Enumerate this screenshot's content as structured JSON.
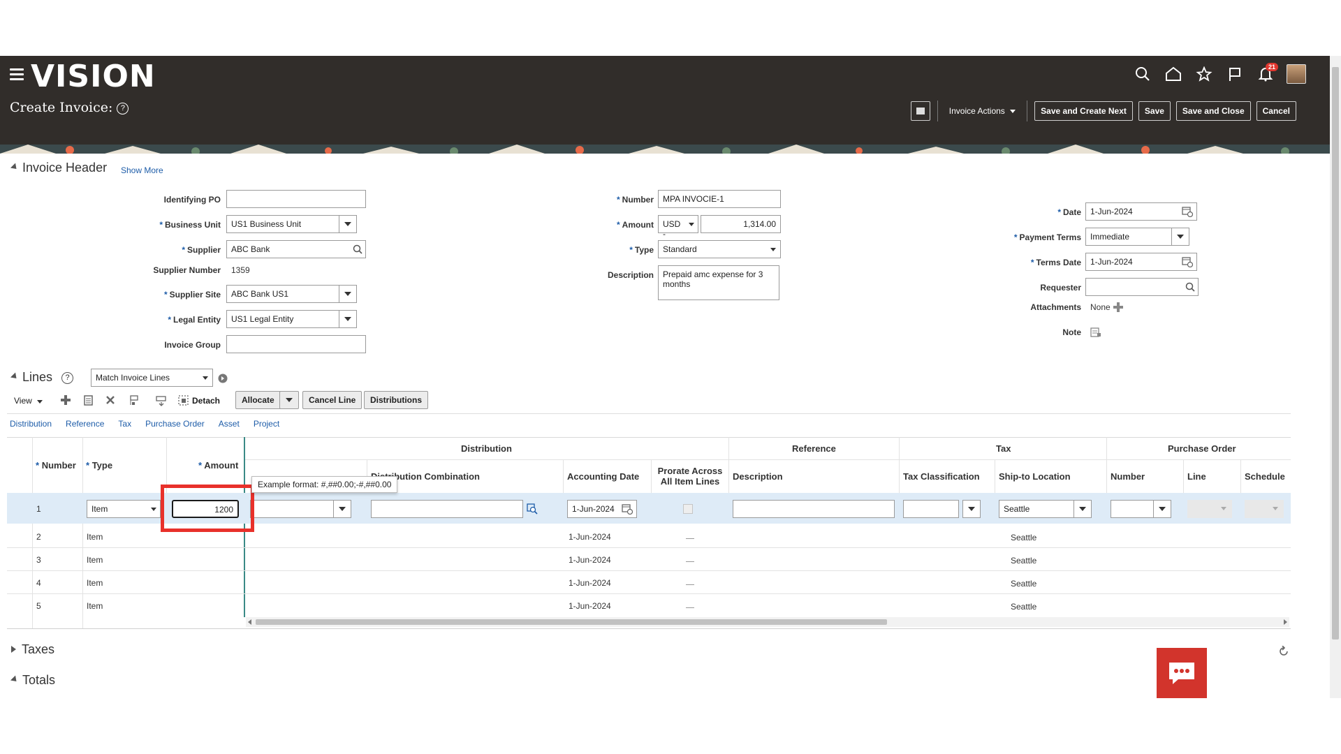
{
  "app": {
    "logo": "VISION",
    "page_title": "Create Invoice:",
    "help": "?",
    "notification_count": "21"
  },
  "header_actions": {
    "invoice_actions": "Invoice Actions",
    "save_create_next": "Save and Create Next",
    "save": "Save",
    "save_close": "Save and Close",
    "cancel": "Cancel"
  },
  "invoice_header": {
    "title": "Invoice Header",
    "show_more": "Show More",
    "identifying_po": {
      "label": "Identifying PO",
      "value": ""
    },
    "business_unit": {
      "label": "Business Unit",
      "value": "US1 Business Unit"
    },
    "supplier": {
      "label": "Supplier",
      "value": "ABC Bank"
    },
    "supplier_number": {
      "label": "Supplier Number",
      "value": "1359"
    },
    "supplier_site": {
      "label": "Supplier Site",
      "value": "ABC Bank US1"
    },
    "legal_entity": {
      "label": "Legal Entity",
      "value": "US1 Legal Entity"
    },
    "invoice_group": {
      "label": "Invoice Group",
      "value": ""
    },
    "number": {
      "label": "Number",
      "value": "MPA INVOCIE-1"
    },
    "amount": {
      "label": "Amount",
      "currency": "USD -",
      "value": "1,314.00"
    },
    "type": {
      "label": "Type",
      "value": "Standard"
    },
    "description": {
      "label": "Description",
      "value": "Prepaid amc expense for 3 months"
    },
    "date": {
      "label": "Date",
      "value": "1-Jun-2024"
    },
    "payment_terms": {
      "label": "Payment Terms",
      "value": "Immediate"
    },
    "terms_date": {
      "label": "Terms Date",
      "value": "1-Jun-2024"
    },
    "requester": {
      "label": "Requester",
      "value": ""
    },
    "attachments": {
      "label": "Attachments",
      "value": "None"
    },
    "note": {
      "label": "Note"
    }
  },
  "lines": {
    "title": "Lines",
    "match_select": "Match Invoice Lines",
    "toolbar": {
      "view": "View",
      "detach": "Detach",
      "allocate": "Allocate",
      "cancel_line": "Cancel Line",
      "distributions": "Distributions"
    },
    "tabs": [
      "Distribution",
      "Reference",
      "Tax",
      "Purchase Order",
      "Asset",
      "Project"
    ],
    "group_headers": {
      "distribution": "Distribution",
      "reference": "Reference",
      "tax": "Tax",
      "purchase_order": "Purchase Order"
    },
    "columns": {
      "number": "Number",
      "type": "Type",
      "amount": "Amount",
      "dist_combination": "Distribution Combination",
      "accounting_date": "Accounting Date",
      "prorate": "Prorate Across All Item Lines",
      "description": "Description",
      "tax_classification": "Tax Classification",
      "ship_to": "Ship-to Location",
      "po_number": "Number",
      "po_line": "Line",
      "po_schedule": "Schedule"
    },
    "tooltip": "Example format: #,##0.00;-#,##0.00",
    "rows": [
      {
        "number": "1",
        "type": "Item",
        "amount": "1200",
        "accounting_date": "1-Jun-2024",
        "ship_to": "Seattle"
      },
      {
        "number": "2",
        "type": "Item",
        "accounting_date": "1-Jun-2024",
        "ship_to": "Seattle"
      },
      {
        "number": "3",
        "type": "Item",
        "accounting_date": "1-Jun-2024",
        "ship_to": "Seattle"
      },
      {
        "number": "4",
        "type": "Item",
        "accounting_date": "1-Jun-2024",
        "ship_to": "Seattle"
      },
      {
        "number": "5",
        "type": "Item",
        "accounting_date": "1-Jun-2024",
        "ship_to": "Seattle"
      }
    ]
  },
  "sections": {
    "taxes": "Taxes",
    "totals": "Totals"
  }
}
